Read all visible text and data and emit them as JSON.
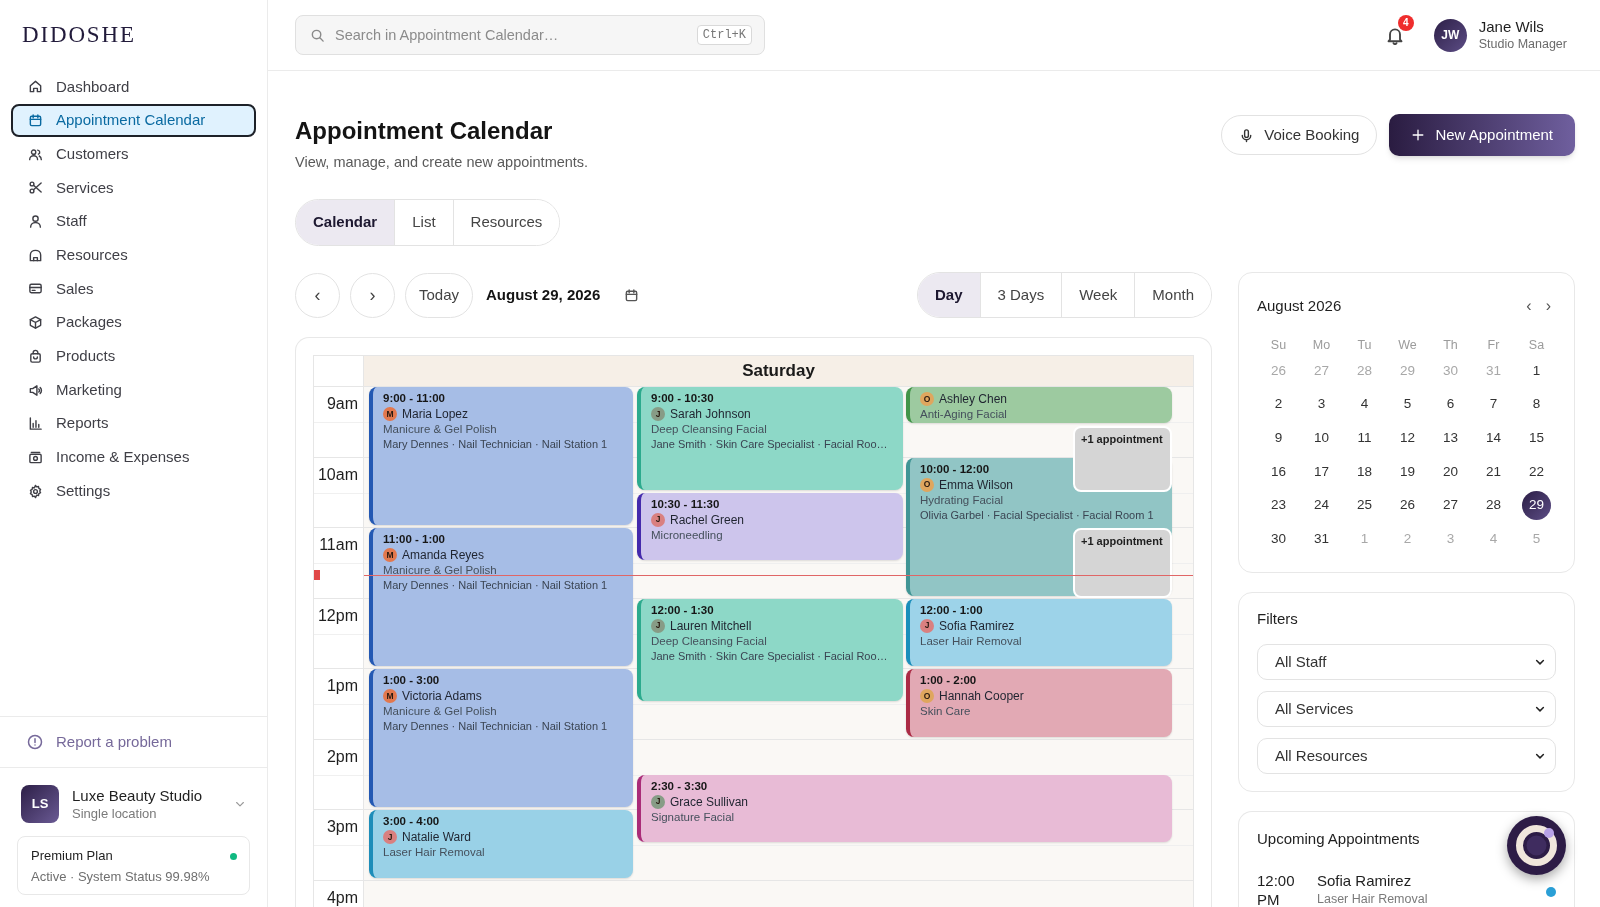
{
  "sidebar": {
    "logo": "DIDOSHE",
    "items": [
      {
        "label": "Dashboard",
        "selected": false
      },
      {
        "label": "Appointment Calendar",
        "selected": true
      },
      {
        "label": "Customers",
        "selected": false
      },
      {
        "label": "Services",
        "selected": false
      },
      {
        "label": "Staff",
        "selected": false
      },
      {
        "label": "Resources",
        "selected": false
      },
      {
        "label": "Sales",
        "selected": false
      },
      {
        "label": "Packages",
        "selected": false
      },
      {
        "label": "Products",
        "selected": false
      },
      {
        "label": "Marketing",
        "selected": false
      },
      {
        "label": "Reports",
        "selected": false
      },
      {
        "label": "Income & Expenses",
        "selected": false
      },
      {
        "label": "Settings",
        "selected": false
      }
    ],
    "report": "Report a problem",
    "studio": {
      "initials": "LS",
      "name": "Luxe Beauty Studio",
      "location": "Single location"
    },
    "plan": {
      "name": "Premium Plan",
      "online": true,
      "status": "Active · System Status 99.98%"
    }
  },
  "topbar": {
    "search": {
      "placeholder": "Search in Appointment Calendar…",
      "shortcut": "Ctrl+K"
    },
    "notifications": {
      "count": "4"
    },
    "user": {
      "initials": "JW",
      "name": "Jane Wils",
      "role": "Studio Manager"
    }
  },
  "header": {
    "title": "Appointment Calendar",
    "subtitle": "View, manage, and create new appointments.",
    "buttons": [
      {
        "label": "Voice Booking",
        "kind": "outline"
      },
      {
        "label": "New Appointment",
        "kind": "primary"
      }
    ]
  },
  "tabs": [
    {
      "label": "Calendar",
      "selected": true
    },
    {
      "label": "List",
      "selected": false
    },
    {
      "label": "Resources",
      "selected": false
    }
  ],
  "toolbar": {
    "prev": "‹",
    "next": "›",
    "today": "Today",
    "date": "August 29, 2026",
    "views": [
      {
        "label": "Day",
        "selected": true
      },
      {
        "label": "3 Days",
        "selected": false
      },
      {
        "label": "Week",
        "selected": false
      },
      {
        "label": "Month",
        "selected": false
      }
    ]
  },
  "calendar": {
    "day": "Saturday",
    "hours": [
      "9am",
      "10am",
      "11am",
      "12pm",
      "1pm",
      "2pm",
      "3pm",
      "4pm"
    ],
    "events": [
      {
        "time": "9:00 - 11:00",
        "client": "Maria Lopez",
        "avatar": {
          "initial": "M",
          "color": "#e2784e"
        },
        "service": "Manicure & Gel Polish",
        "staff": "Mary Dennes · Nail Technician · Nail Station 1",
        "color": "#a6bde6"
      },
      {
        "time": "9:00 - 10:30",
        "client": "Sarah Johnson",
        "avatar": {
          "initial": "J",
          "color": "#879c86"
        },
        "service": "Deep Cleansing Facial",
        "staff": "Jane Smith · Skin Care Specialist · Facial Roo…",
        "color": "#8dd8c7"
      },
      {
        "client": "Ashley Chen",
        "avatar": {
          "initial": "O",
          "color": "#dfa65e"
        },
        "service": "Anti-Aging Facial",
        "color": "#9dcaa0"
      },
      {
        "time": "10:00 - 12:00",
        "client": "Emma Wilson",
        "avatar": {
          "initial": "O",
          "color": "#dfa65e"
        },
        "service": "Hydrating Facial",
        "staff": "Olivia Garbel · Facial Specialist · Facial Room 1",
        "color": "#91c5c5"
      },
      {
        "time": "10:30 - 11:30",
        "client": "Rachel Green",
        "avatar": {
          "initial": "J",
          "color": "#d98080"
        },
        "service": "Microneedling",
        "color": "#cdc5ec"
      },
      {
        "time": "11:00 - 1:00",
        "client": "Amanda Reyes",
        "avatar": {
          "initial": "M",
          "color": "#e2784e"
        },
        "service": "Manicure & Gel Polish",
        "staff": "Mary Dennes · Nail Technician · Nail Station 1",
        "color": "#a6bde6"
      },
      {
        "time": "12:00 - 1:30",
        "client": "Lauren Mitchell",
        "avatar": {
          "initial": "J",
          "color": "#879c86"
        },
        "service": "Deep Cleansing Facial",
        "staff": "Jane Smith · Skin Care Specialist · Facial Roo…",
        "color": "#8dd8c7"
      },
      {
        "time": "12:00 - 1:00",
        "client": "Sofia Ramirez",
        "avatar": {
          "initial": "J",
          "color": "#d98080"
        },
        "service": "Laser Hair Removal",
        "color": "#9dd3e9"
      },
      {
        "time": "1:00 - 3:00",
        "client": "Victoria Adams",
        "avatar": {
          "initial": "M",
          "color": "#e2784e"
        },
        "service": "Manicure & Gel Polish",
        "staff": "Mary Dennes · Nail Technician · Nail Station 1",
        "color": "#a6bde6"
      },
      {
        "time": "1:00 - 2:00",
        "client": "Hannah Cooper",
        "avatar": {
          "initial": "O",
          "color": "#dfa65e"
        },
        "service": "Skin Care",
        "color": "#e2a9b4"
      },
      {
        "time": "2:30 - 3:30",
        "client": "Grace Sullivan",
        "avatar": {
          "initial": "J",
          "color": "#879c86"
        },
        "service": "Signature Facial",
        "color": "#e8bbd6"
      },
      {
        "time": "3:00 - 4:00",
        "client": "Natalie Ward",
        "avatar": {
          "initial": "J",
          "color": "#d98080"
        },
        "service": "Laser Hair Removal",
        "color": "#99d1e7"
      }
    ],
    "more": [
      {
        "label": "+1 appointment"
      },
      {
        "label": "+1 appointment"
      }
    ]
  },
  "mini_calendar": {
    "title": "August 2026",
    "prev": "‹",
    "next": "›",
    "weekdays": [
      "Su",
      "Mo",
      "Tu",
      "We",
      "Th",
      "Fr",
      "Sa"
    ],
    "weeks": [
      [
        {
          "day": "26",
          "outside": true,
          "selected": false
        },
        {
          "day": "27",
          "outside": true,
          "selected": false
        },
        {
          "day": "28",
          "outside": true,
          "selected": false
        },
        {
          "day": "29",
          "outside": true,
          "selected": false
        },
        {
          "day": "30",
          "outside": true,
          "selected": false
        },
        {
          "day": "31",
          "outside": true,
          "selected": false
        },
        {
          "day": "1",
          "outside": false,
          "selected": false
        }
      ],
      [
        {
          "day": "2",
          "outside": false,
          "selected": false
        },
        {
          "day": "3",
          "outside": false,
          "selected": false
        },
        {
          "day": "4",
          "outside": false,
          "selected": false
        },
        {
          "day": "5",
          "outside": false,
          "selected": false
        },
        {
          "day": "6",
          "outside": false,
          "selected": false
        },
        {
          "day": "7",
          "outside": false,
          "selected": false
        },
        {
          "day": "8",
          "outside": false,
          "selected": false
        }
      ],
      [
        {
          "day": "9",
          "outside": false,
          "selected": false
        },
        {
          "day": "10",
          "outside": false,
          "selected": false
        },
        {
          "day": "11",
          "outside": false,
          "selected": false
        },
        {
          "day": "12",
          "outside": false,
          "selected": false
        },
        {
          "day": "13",
          "outside": false,
          "selected": false
        },
        {
          "day": "14",
          "outside": false,
          "selected": false
        },
        {
          "day": "15",
          "outside": false,
          "selected": false
        }
      ],
      [
        {
          "day": "16",
          "outside": false,
          "selected": false
        },
        {
          "day": "17",
          "outside": false,
          "selected": false
        },
        {
          "day": "18",
          "outside": false,
          "selected": false
        },
        {
          "day": "19",
          "outside": false,
          "selected": false
        },
        {
          "day": "20",
          "outside": false,
          "selected": false
        },
        {
          "day": "21",
          "outside": false,
          "selected": false
        },
        {
          "day": "22",
          "outside": false,
          "selected": false
        }
      ],
      [
        {
          "day": "23",
          "outside": false,
          "selected": false
        },
        {
          "day": "24",
          "outside": false,
          "selected": false
        },
        {
          "day": "25",
          "outside": false,
          "selected": false
        },
        {
          "day": "26",
          "outside": false,
          "selected": false
        },
        {
          "day": "27",
          "outside": false,
          "selected": false
        },
        {
          "day": "28",
          "outside": false,
          "selected": false
        },
        {
          "day": "29",
          "outside": false,
          "selected": true
        }
      ],
      [
        {
          "day": "30",
          "outside": false,
          "selected": false
        },
        {
          "day": "31",
          "outside": false,
          "selected": false
        },
        {
          "day": "1",
          "outside": true,
          "selected": false
        },
        {
          "day": "2",
          "outside": true,
          "selected": false
        },
        {
          "day": "3",
          "outside": true,
          "selected": false
        },
        {
          "day": "4",
          "outside": true,
          "selected": false
        },
        {
          "day": "5",
          "outside": true,
          "selected": false
        }
      ]
    ]
  },
  "filters": {
    "title": "Filters",
    "selects": [
      {
        "value": "All Staff"
      },
      {
        "value": "All Services"
      },
      {
        "value": "All Resources"
      }
    ]
  },
  "upcoming": {
    "title": "Upcoming Appointments",
    "items": [
      {
        "time": "12:00 PM",
        "client": "Sofia Ramirez",
        "service": "Laser Hair Removal",
        "color": "#2a9fd6"
      }
    ]
  }
}
